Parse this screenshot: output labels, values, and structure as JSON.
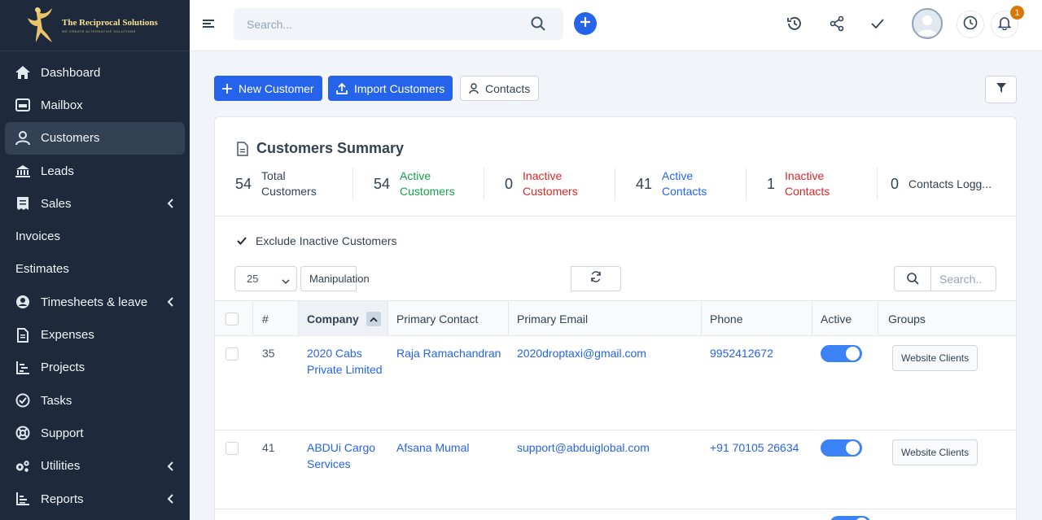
{
  "app": {
    "brand_title": "The Reciprocal Solutions",
    "brand_tagline": "WE CREATE ALTERNATIVE SOLUTIONS"
  },
  "sidebar": {
    "items": [
      {
        "label": "Dashboard",
        "icon": "home-icon"
      },
      {
        "label": "Mailbox",
        "icon": "mailbox-icon"
      },
      {
        "label": "Customers",
        "icon": "user-icon",
        "active": true
      },
      {
        "label": "Leads",
        "icon": "leads-icon"
      },
      {
        "label": "Sales",
        "icon": "receipt-icon",
        "has_submenu": true
      },
      {
        "label": "Invoices"
      },
      {
        "label": "Estimates"
      },
      {
        "label": "Timesheets & leave",
        "icon": "user-circle-icon",
        "has_submenu": true
      },
      {
        "label": "Expenses",
        "icon": "document-icon"
      },
      {
        "label": "Projects",
        "icon": "chart-icon"
      },
      {
        "label": "Tasks",
        "icon": "check-circle-icon"
      },
      {
        "label": "Support",
        "icon": "lifebuoy-icon"
      },
      {
        "label": "Utilities",
        "icon": "cogs-icon",
        "has_submenu": true
      },
      {
        "label": "Reports",
        "icon": "bar-chart-icon",
        "has_submenu": true
      }
    ]
  },
  "header": {
    "search_placeholder": "Search...",
    "notification_count": "1"
  },
  "actions": {
    "new_customer": "New Customer",
    "import_customers": "Import Customers",
    "contacts": "Contacts"
  },
  "summary": {
    "title": "Customers Summary",
    "stats": [
      {
        "value": "54",
        "label": "Total Customers",
        "color": "#334155"
      },
      {
        "value": "54",
        "label": "Active Customers",
        "color": "#16a34a"
      },
      {
        "value": "0",
        "label": "Inactive Customers",
        "color": "#dc2626"
      },
      {
        "value": "41",
        "label": "Active Contacts",
        "color": "#2563eb"
      },
      {
        "value": "1",
        "label": "Inactive Contacts",
        "color": "#dc2626"
      },
      {
        "value": "0",
        "label": "Contacts Logg...",
        "color": "#334155"
      }
    ]
  },
  "filters": {
    "exclude_inactive_label": "Exclude Inactive Customers",
    "exclude_inactive_checked": true,
    "page_size": "25",
    "manipulation_label": "Manipulation",
    "table_search_placeholder": "Search.."
  },
  "table": {
    "columns": [
      "#",
      "Company",
      "Primary Contact",
      "Primary Email",
      "Phone",
      "Active",
      "Groups"
    ],
    "rows": [
      {
        "id": "35",
        "company": "2020 Cabs Private Limited",
        "contact": "Raja Ramachandran",
        "email": "2020droptaxi@gmail.com",
        "phone": "9952412672",
        "active": true,
        "group": "Website Clients"
      },
      {
        "id": "41",
        "company": "ABDUi Cargo Services",
        "contact": "Afsana Mumal",
        "email": "support@abduiglobal.com",
        "phone": "+91 70105 26634",
        "active": true,
        "group": "Website Clients"
      }
    ]
  },
  "colors": {
    "sidebar_bg": "#1e293b",
    "primary": "#2563eb",
    "badge": "#d97706"
  }
}
